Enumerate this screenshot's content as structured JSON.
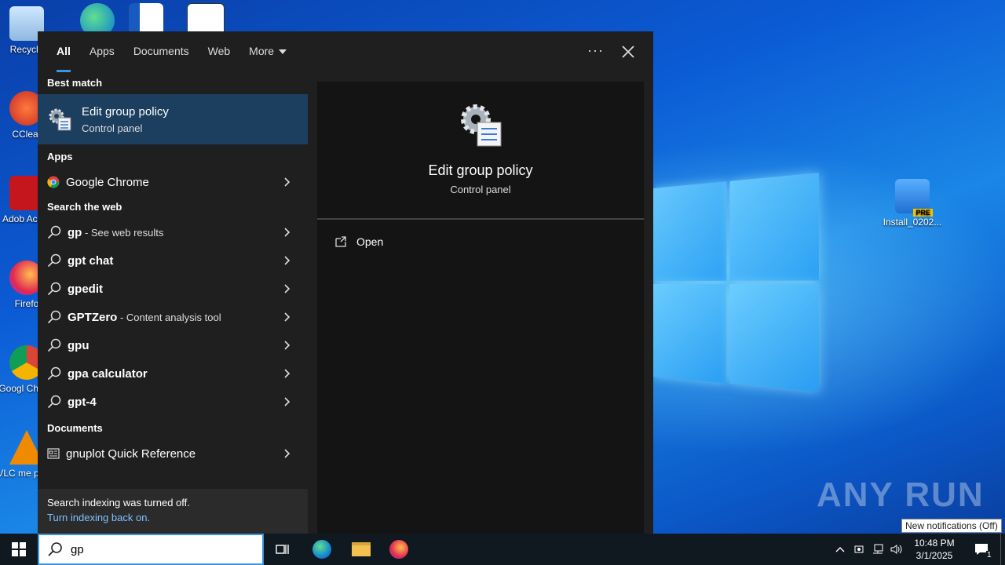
{
  "desktop": {
    "icons": [
      {
        "label": "Recycle",
        "name": "recycle-bin"
      },
      {
        "label": "CClear",
        "name": "ccleaner"
      },
      {
        "label": "Adob Acrob",
        "name": "adobe-acrobat"
      },
      {
        "label": "Firefo",
        "name": "firefox"
      },
      {
        "label": "Googl Chrom",
        "name": "google-chrome"
      },
      {
        "label": "VLC me playe",
        "name": "vlc"
      }
    ],
    "install_icon_label": "Install_0202...",
    "install_badge": "PRE",
    "watermark": "ANY RUN",
    "notification_tooltip": "New notifications (Off)"
  },
  "search": {
    "tabs": [
      "All",
      "Apps",
      "Documents",
      "Web",
      "More"
    ],
    "best_match": {
      "section": "Best match",
      "title": "Edit group policy",
      "subtitle": "Control panel"
    },
    "apps": {
      "section": "Apps",
      "items": [
        "Google Chrome"
      ]
    },
    "web": {
      "section": "Search the web",
      "items": [
        {
          "bold": "gp",
          "suffix": " - See web results"
        },
        {
          "bold": "gpt chat",
          "suffix": ""
        },
        {
          "bold": "gpedit",
          "suffix": ""
        },
        {
          "bold": "GPTZero",
          "suffix": " - Content analysis tool"
        },
        {
          "bold": "gpu",
          "suffix": ""
        },
        {
          "bold": "gpa calculator",
          "suffix": ""
        },
        {
          "bold": "gpt-4",
          "suffix": ""
        }
      ]
    },
    "documents": {
      "section": "Documents",
      "items": [
        "gnuplot Quick Reference"
      ]
    },
    "notice": {
      "text": "Search indexing was turned off.",
      "link": "Turn indexing back on."
    },
    "preview": {
      "title": "Edit group policy",
      "subtitle": "Control panel",
      "action": "Open"
    },
    "query": "gp"
  },
  "taskbar": {
    "time": "10:48 PM",
    "date": "3/1/2025",
    "notification_count": "1"
  }
}
